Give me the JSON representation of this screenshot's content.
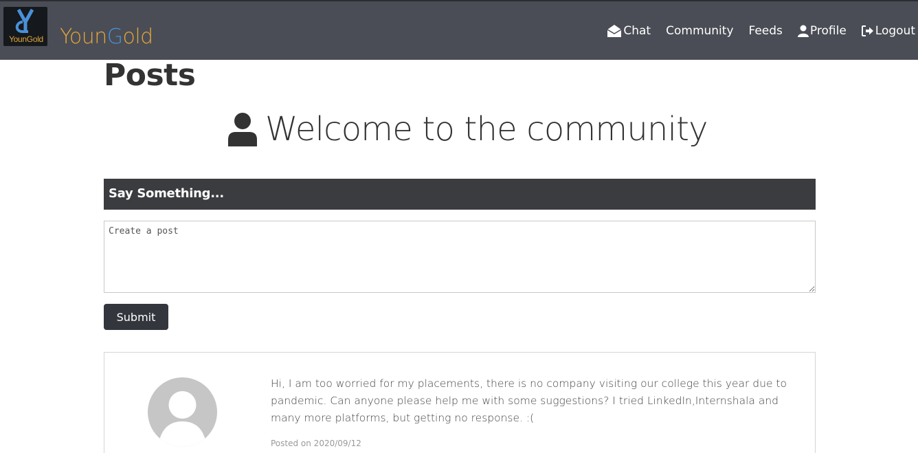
{
  "navbar": {
    "logo_text": "YounGold",
    "brand_prefix": "Youn",
    "brand_highlight": "G",
    "brand_suffix": "old",
    "links": [
      {
        "label": "Chat",
        "icon": "envelope-open-icon"
      },
      {
        "label": "Community",
        "icon": ""
      },
      {
        "label": "Feeds",
        "icon": ""
      },
      {
        "label": "Profile",
        "icon": "user-icon"
      },
      {
        "label": "Logout",
        "icon": "sign-out-icon"
      }
    ]
  },
  "main": {
    "title": "Posts",
    "welcome": "Welcome to the community",
    "compose": {
      "header": "Say Something...",
      "placeholder": "Create a post",
      "value": "",
      "submit_label": "Submit"
    },
    "posts": [
      {
        "body": "Hi, I am too worried for my placements, there is no company visiting our college this year due to pandemic. Can anyone please help me with some suggestions? I tried LinkedIn,Internshala and many more platforms, but getting no response. :(",
        "posted_label": "Posted on 2020/09/12"
      }
    ]
  },
  "colors": {
    "navbar_bg": "#4a4d55",
    "brand_gold": "#e6a63a",
    "brand_blue": "#4a90d9",
    "header_bar": "#3a3c3f",
    "button_bg": "#33373d"
  }
}
